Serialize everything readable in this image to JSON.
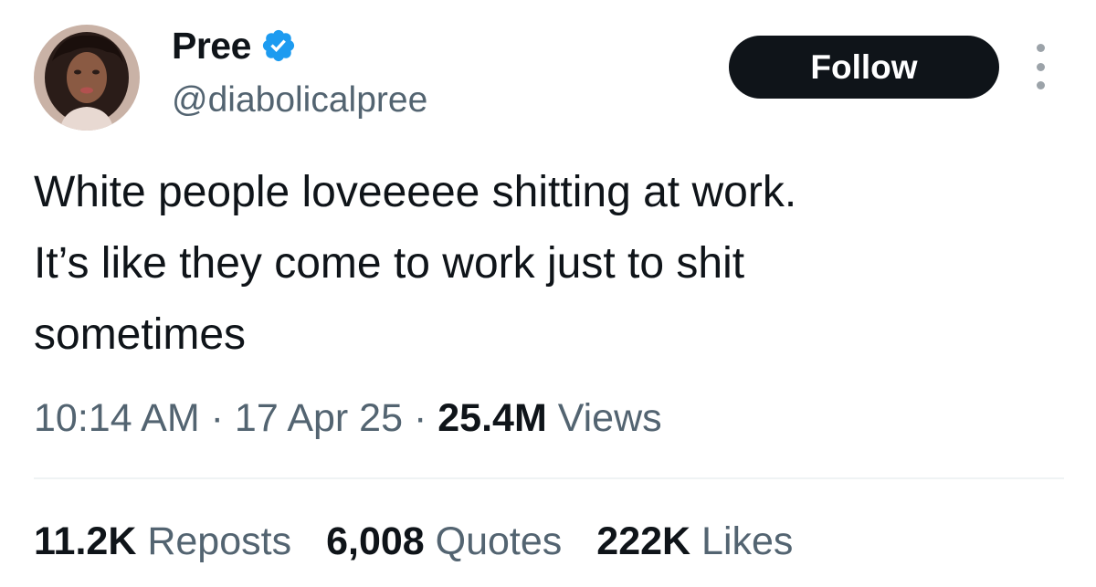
{
  "tweet": {
    "author": {
      "display_name": "Pree",
      "handle": "@diabolicalpree",
      "verified": true,
      "avatar_icon": "profile-photo"
    },
    "follow_label": "Follow",
    "more_icon": "more-options-icon",
    "text_lines": [
      "White people loveeeee shitting at work.",
      "It’s like they come to work just to shit",
      "sometimes"
    ],
    "time": "10:14 AM",
    "date": "17 Apr 25",
    "separator": "·",
    "views_count": "25.4M",
    "views_label": "Views",
    "stats": {
      "reposts": {
        "count": "11.2K",
        "label": "Reposts"
      },
      "quotes": {
        "count": "6,008",
        "label": "Quotes"
      },
      "likes": {
        "count": "222K",
        "label": "Likes"
      }
    }
  },
  "colors": {
    "text_primary": "#0f1419",
    "text_secondary": "#536471",
    "verified_blue": "#1d9bf0",
    "follow_bg": "#0f1419",
    "follow_text": "#ffffff",
    "divider": "#eff3f4"
  }
}
